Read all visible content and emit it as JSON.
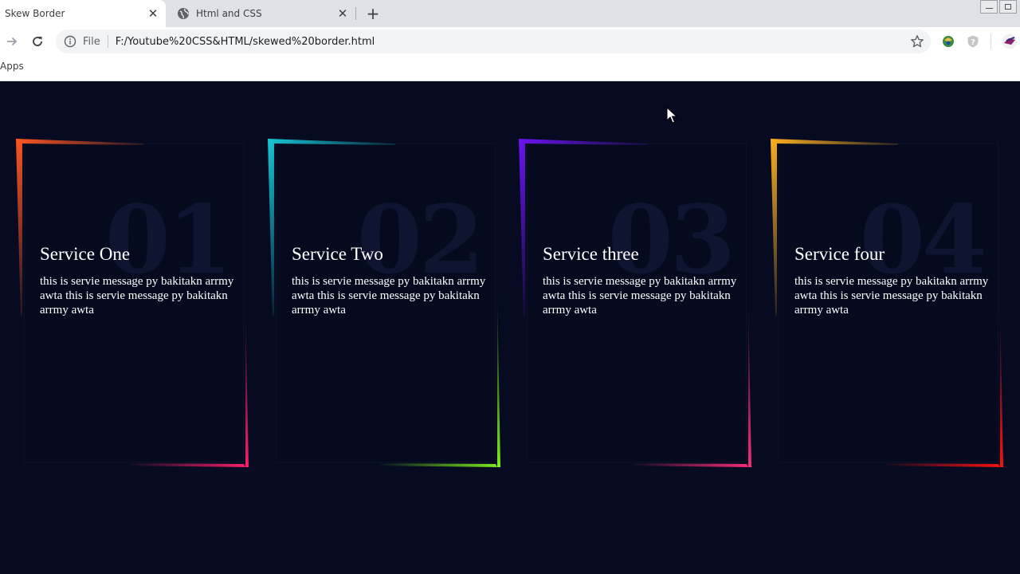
{
  "browser": {
    "tabs": [
      {
        "title": "Skew Border",
        "active": true,
        "close": "✕"
      },
      {
        "title": "Html and CSS",
        "active": false,
        "close": "✕"
      }
    ],
    "new_tab": "+",
    "address": {
      "scheme": "File",
      "url": "F:/Youtube%20CSS&HTML/skewed%20border.html"
    },
    "bookmarks": {
      "apps_label": "Apps"
    }
  },
  "cards": [
    {
      "number": "01",
      "title": "Service One",
      "text": "this is servie message py bakitakn arrmy awta this is servie message py bakitakn arrmy awta",
      "color_a": "#ff5722",
      "color_b": "#ff1f6b"
    },
    {
      "number": "02",
      "title": "Service Two",
      "text": "this is servie message py bakitakn arrmy awta this is servie message py bakitakn arrmy awta",
      "color_a": "#16c8d6",
      "color_b": "#7df21c"
    },
    {
      "number": "03",
      "title": "Service three",
      "text": "this is servie message py bakitakn arrmy awta this is servie message py bakitakn arrmy awta",
      "color_a": "#6c13f2",
      "color_b": "#ff2d7a"
    },
    {
      "number": "04",
      "title": "Service four",
      "text": "this is servie message py bakitakn arrmy awta this is servie message py bakitakn arrmy awta",
      "color_a": "#ffb11f",
      "color_b": "#ff1010"
    }
  ],
  "colors": {
    "page_bg": "#060b21"
  }
}
